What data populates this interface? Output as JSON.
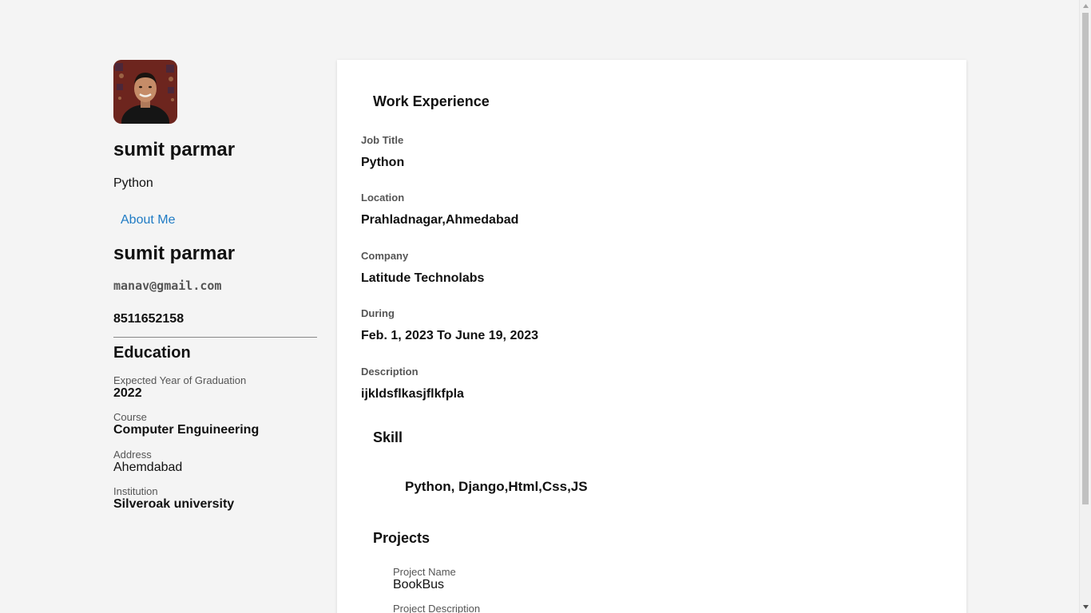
{
  "profile": {
    "name": "sumit parmar",
    "title": "Python",
    "about_link": "About Me",
    "name_repeat": "sumit parmar",
    "email": "manav@gmail.com",
    "phone": "8511652158"
  },
  "education": {
    "heading": "Education",
    "items": [
      {
        "label": "Expected Year of Graduation",
        "value": "2022"
      },
      {
        "label": "Course",
        "value": "Computer Enguineering"
      },
      {
        "label": "Address",
        "value": "Ahemdabad"
      },
      {
        "label": "Institution",
        "value": "Silveroak university"
      }
    ]
  },
  "work": {
    "heading": "Work Experience",
    "fields": [
      {
        "label": "Job Title",
        "value": "Python"
      },
      {
        "label": "Location",
        "value": "Prahladnagar,Ahmedabad"
      },
      {
        "label": "Company",
        "value": "Latitude Technolabs"
      },
      {
        "label": "During",
        "value": "Feb. 1, 2023 To June 19, 2023"
      },
      {
        "label": "Description",
        "value": "ijkldsflkasjflkfpla"
      }
    ]
  },
  "skills": {
    "heading": "Skill",
    "value": "Python, Django,Html,Css,JS"
  },
  "projects": {
    "heading": "Projects",
    "items": [
      {
        "label": "Project Name",
        "value": "BookBus"
      },
      {
        "label": "Project Description",
        "value": ""
      }
    ]
  },
  "colors": {
    "background": "#f4f4f4",
    "card": "#ffffff",
    "link": "#1f7bc4",
    "label": "#555555"
  }
}
